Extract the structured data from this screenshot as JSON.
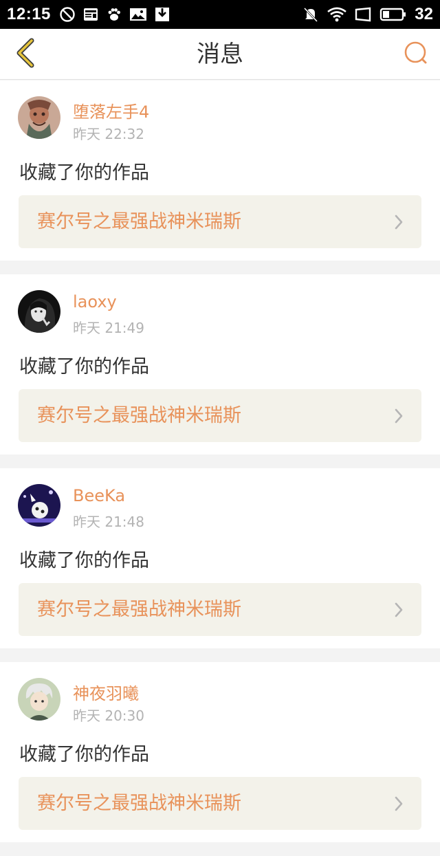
{
  "status_bar": {
    "time": "12:15",
    "battery": "32",
    "icons": [
      "no-disturb-icon",
      "news-icon",
      "paw-icon",
      "image-icon",
      "download-icon",
      "mute-icon",
      "wifi-icon",
      "window-icon",
      "battery-icon"
    ]
  },
  "header": {
    "title": "消息",
    "back_icon": "chevron-left-icon",
    "search_icon": "search-icon"
  },
  "colors": {
    "accent": "#e8925a",
    "back": "#e6c43c",
    "card_bg": "#ffffff",
    "link_bg": "#f3f2ea",
    "page_bg": "#f3f3f3"
  },
  "messages": [
    {
      "user": "堕落左手4",
      "time": "昨天 22:32",
      "action": "收藏了你的作品",
      "work": "赛尔号之最强战神米瑞斯"
    },
    {
      "user": "laoxy",
      "time": "昨天 21:49",
      "action": "收藏了你的作品",
      "work": "赛尔号之最强战神米瑞斯"
    },
    {
      "user": "BeeKa",
      "time": "昨天 21:48",
      "action": "收藏了你的作品",
      "work": "赛尔号之最强战神米瑞斯"
    },
    {
      "user": "神夜羽曦",
      "time": "昨天 20:30",
      "action": "收藏了你的作品",
      "work": "赛尔号之最强战神米瑞斯"
    }
  ]
}
